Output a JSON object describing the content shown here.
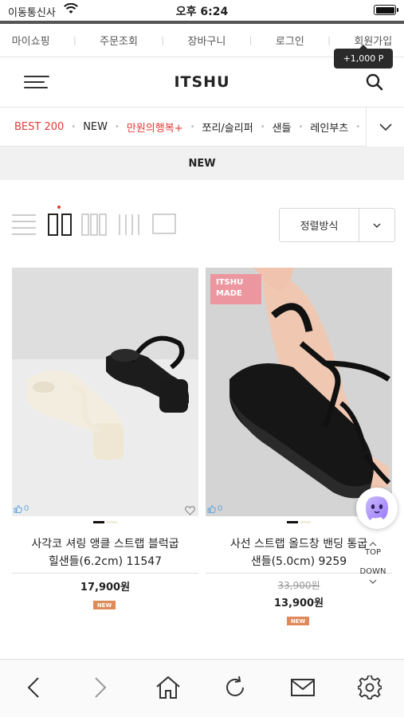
{
  "status_bar": {
    "carrier": "이동통신사",
    "time": "오후 6:24"
  },
  "util_nav": {
    "items": [
      "마이쇼핑",
      "주문조회",
      "장바구니",
      "로그인",
      "회원가입"
    ]
  },
  "point_badge": "+1,000 P",
  "header": {
    "logo": "ITSHU"
  },
  "categories": [
    {
      "label": "BEST 200",
      "color": "#e53935"
    },
    {
      "label": "NEW",
      "color": "#222222"
    },
    {
      "label": "만원의행복+",
      "color": "#e53935"
    },
    {
      "label": "쪼리/슬리퍼",
      "color": "#222222"
    },
    {
      "label": "샌들",
      "color": "#222222"
    },
    {
      "label": "레인부츠",
      "color": "#222222"
    }
  ],
  "section_title": "NEW",
  "sort": {
    "label": "정렬방식"
  },
  "products": [
    {
      "name_line1": "사각코 셔링 앵클 스트랩 블럭굽",
      "name_line2": "힐샌들(6.2cm) 11547",
      "original_price": "",
      "price": "17,900원",
      "badge": "NEW",
      "likes": "0"
    },
    {
      "name_line1": "사선 스트랩 올드창 밴딩 통굽",
      "name_line2": "샌들(5.0cm) 9259",
      "original_price": "33,900원",
      "price": "13,900원",
      "badge": "NEW",
      "likes": "0",
      "image_badge_line1": "ITSHU",
      "image_badge_line2": "MADE"
    }
  ],
  "floating": {
    "top_label": "TOP",
    "down_label": "DOWN"
  },
  "colors": {
    "accent_red": "#e53935",
    "new_badge": "#e0895a",
    "dark_badge": "#2a2a2a"
  }
}
